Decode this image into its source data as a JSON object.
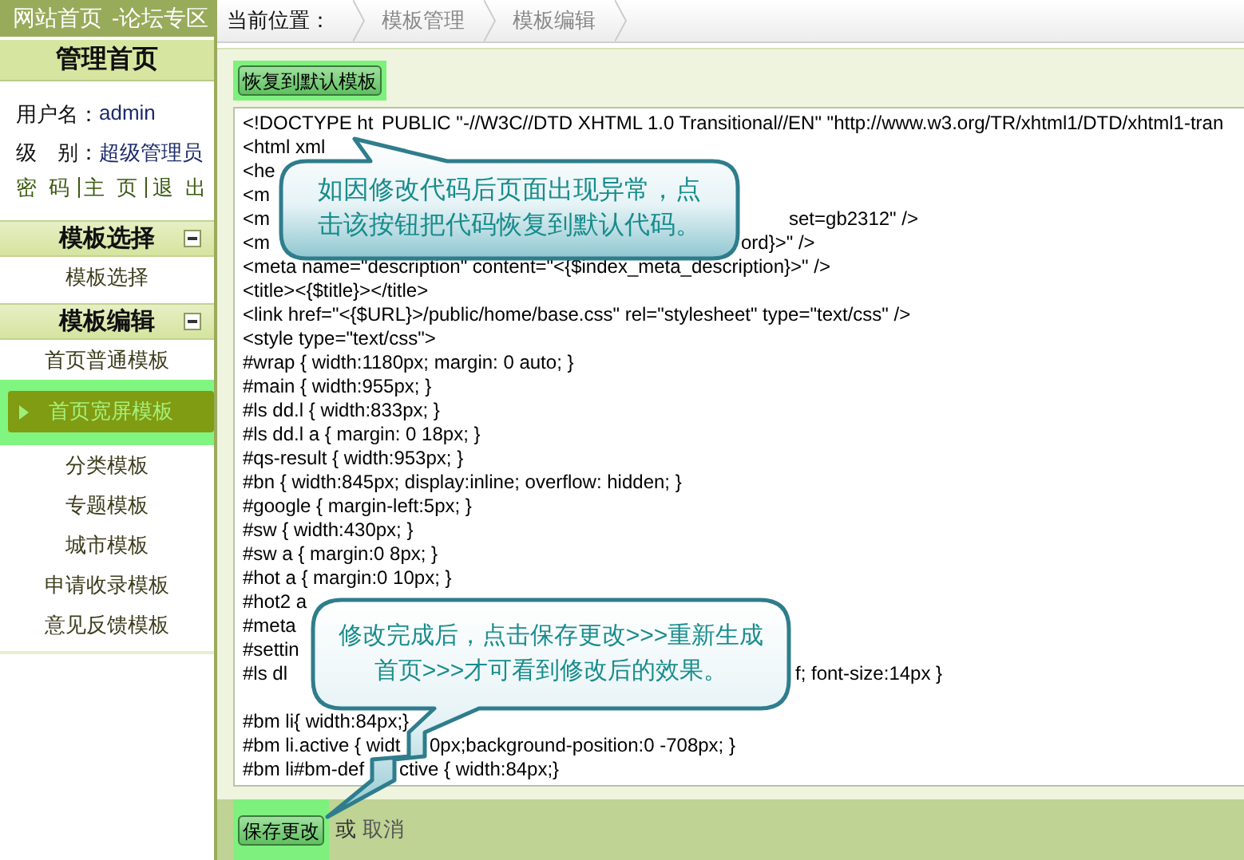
{
  "header": {
    "links": [
      "网站首页",
      "-论坛专区"
    ]
  },
  "sidebar": {
    "title": "管理首页",
    "user": [
      {
        "label": "用户名：",
        "value": "admin"
      },
      {
        "label": "级　别：",
        "value": "超级管理员"
      }
    ],
    "links": [
      "密 码",
      "主 页",
      "退 出"
    ],
    "sections": [
      {
        "title": "模板选择",
        "expanded": true,
        "items": [
          {
            "label": "模板选择",
            "selected": false
          }
        ]
      },
      {
        "title": "模板编辑",
        "expanded": true,
        "items": [
          {
            "label": "首页普通模板",
            "selected": false
          },
          {
            "label": "首页宽屏模板",
            "selected": true
          },
          {
            "label": "分类模板",
            "selected": false
          },
          {
            "label": "专题模板",
            "selected": false
          },
          {
            "label": "城市模板",
            "selected": false
          },
          {
            "label": "申请收录模板",
            "selected": false
          },
          {
            "label": "意见反馈模板",
            "selected": false
          }
        ]
      }
    ]
  },
  "breadcrumb": {
    "label": "当前位置：",
    "items": [
      "模板管理",
      "模板编辑"
    ]
  },
  "restore_button": {
    "label": "恢复到默认模板",
    "highlighted": true
  },
  "code_lines": [
    {
      "parts": [
        "<!DOCTYPE ht",
        "PUBLIC \"-//W3C//DTD XHTML 1.0 Transitional//EN\" \"http://www.w3.org/TR/xhtml1/DTD/xhtml1-tran"
      ]
    },
    {
      "parts": [
        "<html xml"
      ]
    },
    {
      "parts": [
        "<he"
      ]
    },
    {
      "parts": [
        "<m"
      ]
    },
    {
      "parts": [
        "<m",
        "set=gb2312\" />"
      ]
    },
    {
      "parts": [
        "<m",
        "ord}>\" />"
      ]
    },
    {
      "parts": [
        "<meta name=\"description\" content=\"<{$index_meta_description}>\" />"
      ]
    },
    {
      "parts": [
        "<title><{$title}></title>"
      ]
    },
    {
      "parts": [
        "<link href=\"<{$URL}>/public/home/base.css\" rel=\"stylesheet\" type=\"text/css\" />"
      ]
    },
    {
      "parts": [
        "<style type=\"text/css\">"
      ]
    },
    {
      "parts": [
        "#wrap { width:1180px; margin: 0 auto; }"
      ]
    },
    {
      "parts": [
        "#main { width:955px; }"
      ]
    },
    {
      "parts": [
        "#ls dd.l { width:833px; }"
      ]
    },
    {
      "parts": [
        "#ls dd.l a { margin: 0 18px; }"
      ]
    },
    {
      "parts": [
        "#qs-result { width:953px; }"
      ]
    },
    {
      "parts": [
        "#bn { width:845px; display:inline; overflow: hidden; }"
      ]
    },
    {
      "parts": [
        "#google { margin-left:5px; }"
      ]
    },
    {
      "parts": [
        "#sw { width:430px; }"
      ]
    },
    {
      "parts": [
        "#sw a { margin:0 8px; }"
      ]
    },
    {
      "parts": [
        "#hot a { margin:0 10px; }"
      ]
    },
    {
      "parts": [
        "#hot2 a"
      ]
    },
    {
      "parts": [
        "#meta"
      ]
    },
    {
      "parts": [
        "#settin"
      ]
    },
    {
      "parts": [
        "#ls dl",
        "f; font-size:14px }"
      ]
    },
    {
      "parts": [
        "#bm li{ width:84px;}"
      ],
      "gap_before": true
    },
    {
      "parts": [
        "#bm li.active { widt",
        "0px;background-position:0 -708px; }"
      ]
    },
    {
      "parts": [
        "#bm li#bm-def",
        "ctive { width:84px;}"
      ]
    }
  ],
  "callouts": [
    {
      "kind": "top",
      "text": "如因修改代码后页面出现异常，点击该按钮把代码恢复到默认代码。"
    },
    {
      "kind": "bottom",
      "text": "修改完成后，点击保存更改>>>重新生成首页>>>才可看到修改后的效果。"
    }
  ],
  "footer": {
    "save_button": {
      "label": "保存更改",
      "highlighted": true
    },
    "or": "或",
    "cancel": "取消"
  }
}
